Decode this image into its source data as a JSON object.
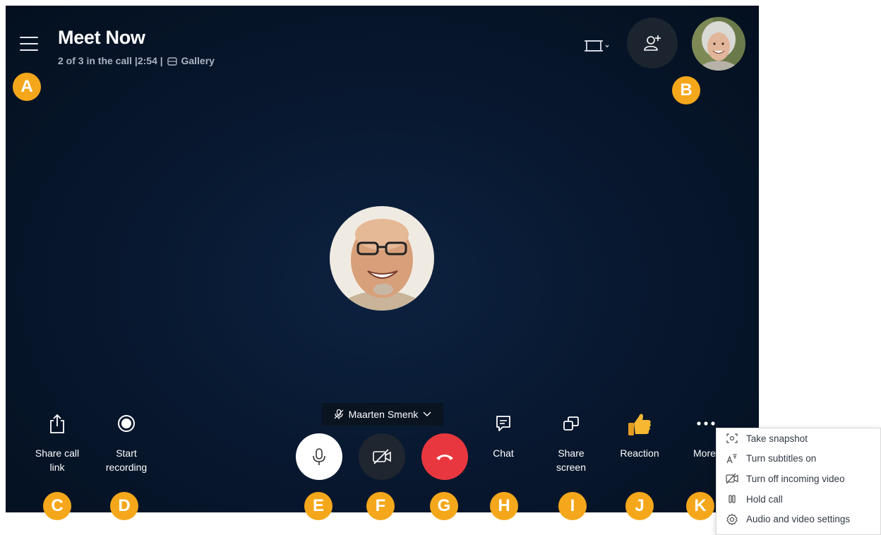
{
  "header": {
    "title": "Meet Now",
    "participants": "2 of 3 in the call",
    "duration": "2:54",
    "separator": "|",
    "view_mode": "Gallery"
  },
  "icons": {
    "menu": "hamburger-icon",
    "layout": "layout-toggle-icon",
    "add_person": "add-person-icon",
    "share": "share-icon",
    "record": "record-icon",
    "mic": "microphone-icon",
    "camera": "camera-off-icon",
    "hangup": "end-call-icon",
    "chat": "chat-icon",
    "share_screen": "share-screen-icon",
    "reaction": "thumbs-up-icon",
    "more": "more-icon"
  },
  "speaker": {
    "name": "Maarten Smenk"
  },
  "controls": {
    "share_call_link": "Share call link",
    "start_recording": "Start recording",
    "chat": "Chat",
    "share_screen": "Share screen",
    "reaction": "Reaction",
    "more": "More"
  },
  "more_menu": {
    "items": [
      "Take snapshot",
      "Turn subtitles on",
      "Turn off incoming video",
      "Hold call",
      "Audio and video settings"
    ]
  },
  "badges": [
    "A",
    "B",
    "C",
    "D",
    "E",
    "F",
    "G",
    "H",
    "I",
    "J",
    "K"
  ],
  "colors": {
    "background": "#081830",
    "badge": "#f5a71b",
    "end_call": "#e8373e",
    "mic_button": "#ffffff",
    "camera_button": "#1f262f"
  }
}
